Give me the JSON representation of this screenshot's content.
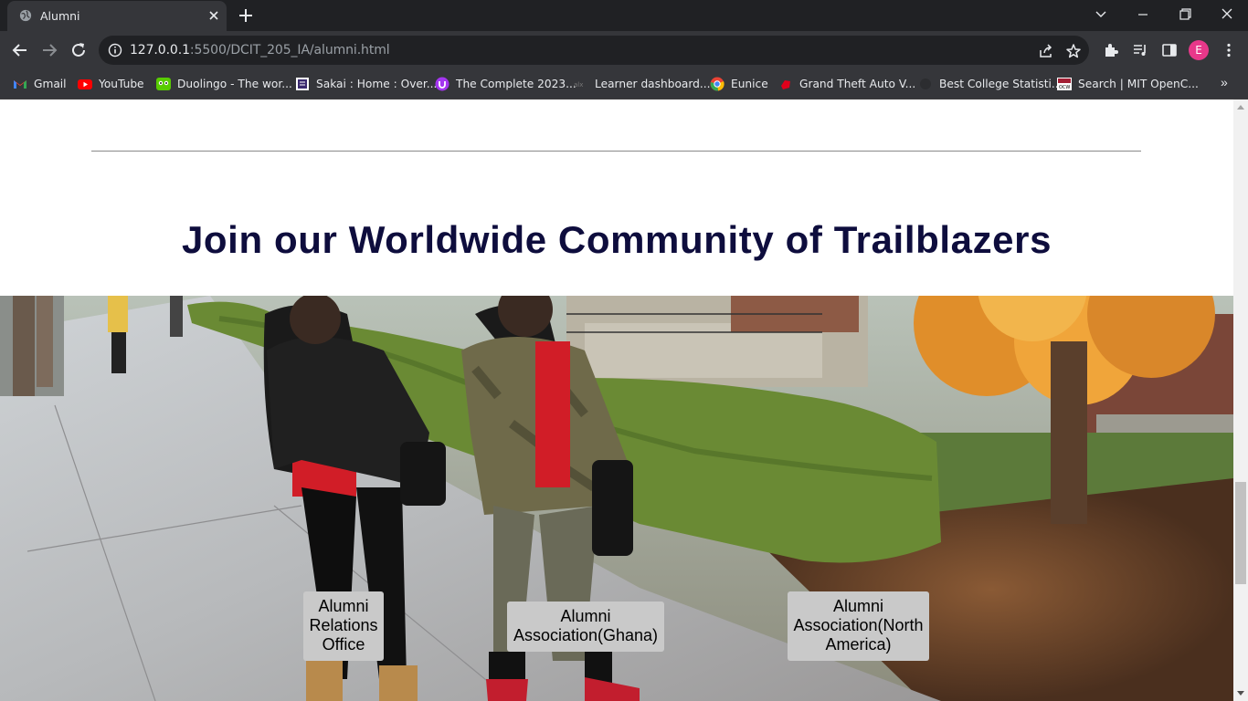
{
  "browser": {
    "tab": {
      "title": "Alumni",
      "favicon": "globe-icon"
    },
    "url_host": "127.0.0.1",
    "url_rest": ":5500/DCIT_205_IA/alumni.html",
    "profile_initial": "E",
    "bookmarks": [
      {
        "label": "Gmail",
        "icon": "gmail-icon"
      },
      {
        "label": "YouTube",
        "icon": "youtube-icon"
      },
      {
        "label": "Duolingo - The wor...",
        "icon": "duolingo-icon"
      },
      {
        "label": "Sakai : Home : Over...",
        "icon": "sakai-icon"
      },
      {
        "label": "The Complete 2023...",
        "icon": "udemy-icon"
      },
      {
        "label": "Learner dashboard...",
        "icon": "alx-icon"
      },
      {
        "label": "Eunice",
        "icon": "chrome-profile-icon"
      },
      {
        "label": "Grand Theft Auto V...",
        "icon": "gta-icon"
      },
      {
        "label": "Best College Statisti...",
        "icon": "site-icon"
      },
      {
        "label": "Search | MIT OpenC...",
        "icon": "mit-ocw-icon"
      }
    ],
    "bookmarks_overflow": "»"
  },
  "page": {
    "heading": "Join our Worldwide Community of Trailblazers",
    "cards": [
      {
        "lines": [
          "Alumni",
          "Relations",
          "Office"
        ]
      },
      {
        "lines": [
          "Alumni",
          "Association(Ghana)"
        ]
      },
      {
        "lines": [
          "Alumni",
          "Association(North",
          "America)"
        ]
      }
    ]
  },
  "colors": {
    "heading": "#0e0d3d",
    "card_bg": "#c9c9c9",
    "profile": "#e8388a"
  }
}
